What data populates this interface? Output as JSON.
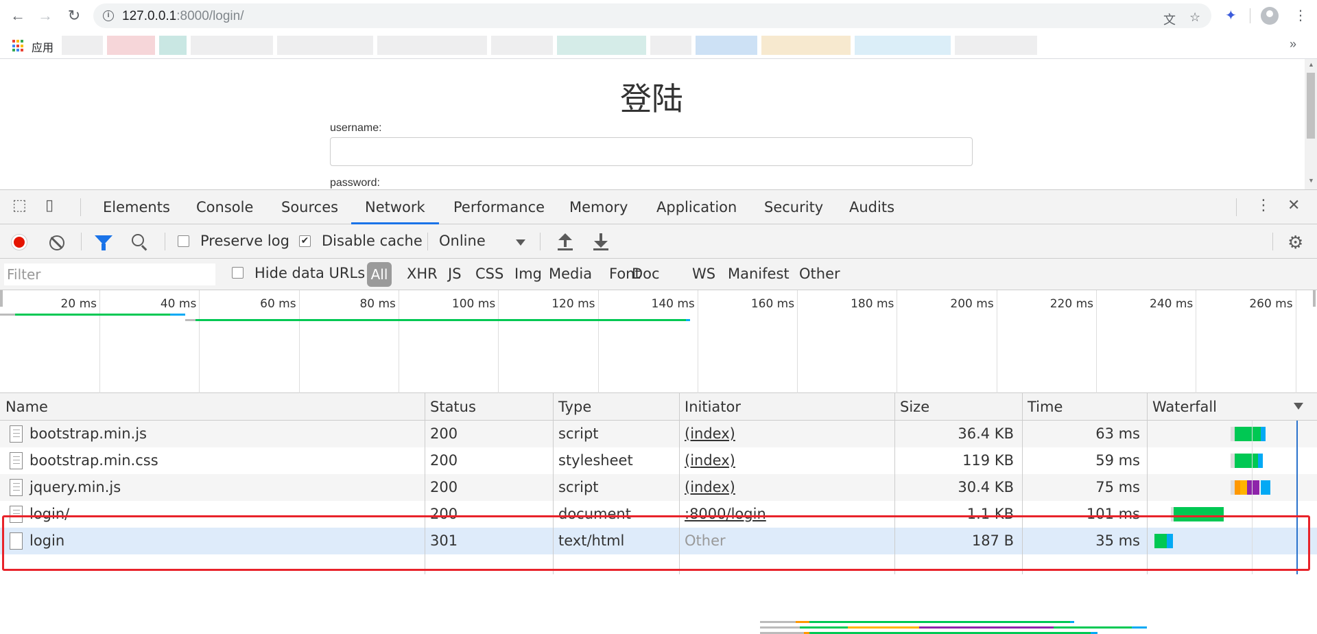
{
  "browser": {
    "url_host": "127.0.0.1",
    "url_rest": ":8000/login/",
    "bookmarks_apps_label": "应用",
    "bookmarks_more": "»"
  },
  "page": {
    "title": "登陆",
    "username_label": "username:",
    "password_label": "password:"
  },
  "devtools": {
    "tabs": [
      {
        "label": "Elements"
      },
      {
        "label": "Console"
      },
      {
        "label": "Sources"
      },
      {
        "label": "Network",
        "active": true
      },
      {
        "label": "Performance"
      },
      {
        "label": "Memory"
      },
      {
        "label": "Application"
      },
      {
        "label": "Security"
      },
      {
        "label": "Audits"
      }
    ],
    "toolbar": {
      "preserve_log": "Preserve log",
      "preserve_log_checked": false,
      "disable_cache": "Disable cache",
      "disable_cache_checked": true,
      "throttling": "Online"
    },
    "filterbar": {
      "filter_placeholder": "Filter",
      "hide_data_urls": "Hide data URLs",
      "hide_data_urls_checked": false,
      "types": [
        "All",
        "XHR",
        "JS",
        "CSS",
        "Img",
        "Media",
        "Font",
        "Doc",
        "WS",
        "Manifest",
        "Other"
      ],
      "active_type": "All"
    },
    "overview": {
      "tick_labels": [
        "20 ms",
        "40 ms",
        "60 ms",
        "80 ms",
        "100 ms",
        "120 ms",
        "140 ms",
        "160 ms",
        "180 ms",
        "200 ms",
        "220 ms",
        "240 ms",
        "260 ms"
      ]
    },
    "columns": [
      "Name",
      "Status",
      "Type",
      "Initiator",
      "Size",
      "Time",
      "Waterfall"
    ],
    "requests": [
      {
        "name": "bootstrap.min.js",
        "status": "200",
        "type": "script",
        "initiator": "(index)",
        "initiator_link": true,
        "size": "36.4 KB",
        "time": "63 ms"
      },
      {
        "name": "bootstrap.min.css",
        "status": "200",
        "type": "stylesheet",
        "initiator": "(index)",
        "initiator_link": true,
        "size": "119 KB",
        "time": "59 ms"
      },
      {
        "name": "jquery.min.js",
        "status": "200",
        "type": "script",
        "initiator": "(index)",
        "initiator_link": true,
        "size": "30.4 KB",
        "time": "75 ms"
      },
      {
        "name": "login/",
        "status": "200",
        "type": "document",
        "initiator": ":8000/login",
        "initiator_link": true,
        "size": "1.1 KB",
        "time": "101 ms"
      },
      {
        "name": "login",
        "status": "301",
        "type": "text/html",
        "initiator": "Other",
        "initiator_link": false,
        "size": "187 B",
        "time": "35 ms",
        "selected": true
      }
    ],
    "colors": {
      "accent": "#1a73e8",
      "record": "#e51400",
      "waiting": "#00c853",
      "download": "#03a9f4",
      "highlight": "#e8232a"
    }
  }
}
